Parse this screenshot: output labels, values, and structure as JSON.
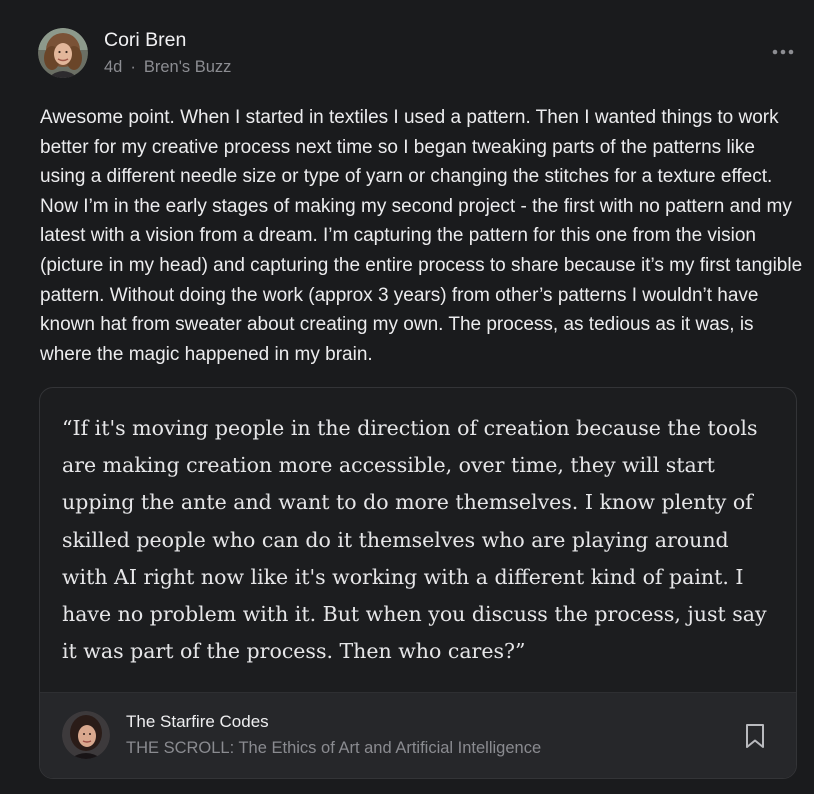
{
  "post": {
    "author": {
      "name": "Cori Bren",
      "avatar": "avatar-woman-curly-hair"
    },
    "time_ago": "4d",
    "separator": "·",
    "publication": "Bren's Buzz",
    "more_icon": "more-horizontal-icon",
    "body": "Awesome point. When I started in textiles I used a pattern. Then I wanted things to work better for my creative process next time so I began tweaking parts of the patterns like using a different needle size or type of yarn or changing the stitches for a texture effect. Now I’m in the early stages of making my second project - the first with no pattern and my latest with a vision from a dream. I’m capturing the pattern for this one from the vision (picture in my head) and capturing the entire process to share because it’s my first tangible pattern. Without doing the work (approx 3 years) from other’s patterns I wouldn’t have known hat from sweater about creating my own. The process, as tedious as it was, is where the magic happened in my brain."
  },
  "quote": {
    "text": "“If it's moving people in the direction of creation because the tools are making creation more accessible, over time, they will start upping the ante and want to do more themselves. I know plenty of skilled people who can do it themselves who are playing around with AI right now like it's working with a different kind of paint. I have no problem with it. But when you discuss the process, just say it was part of the process. Then who cares?”",
    "source": {
      "name": "The Starfire Codes",
      "post_title": "THE SCROLL: The Ethics of Art and Artificial Intelligence",
      "avatar": "avatar-woman-dark-hair",
      "bookmark_icon": "bookmark-icon"
    }
  },
  "colors": {
    "background": "#1a1b1d",
    "text": "#ececee",
    "muted": "#8c8d92",
    "card_border": "#333437",
    "source_bar": "#26272a"
  }
}
